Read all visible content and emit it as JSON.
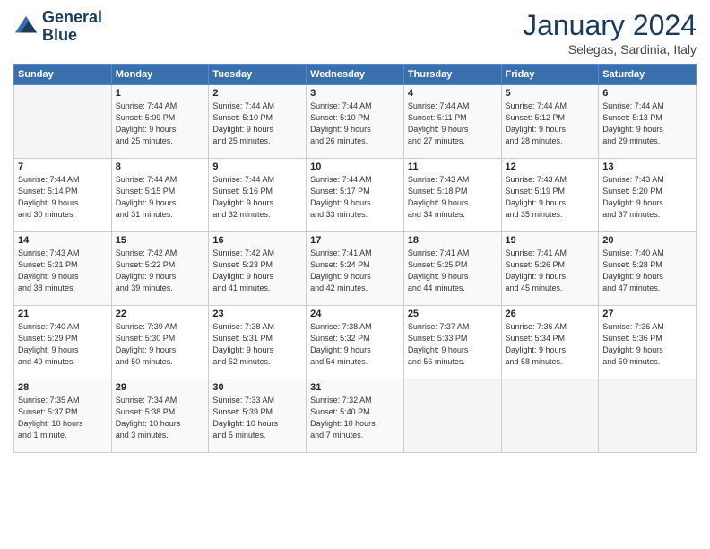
{
  "header": {
    "logo_line1": "General",
    "logo_line2": "Blue",
    "month": "January 2024",
    "location": "Selegas, Sardinia, Italy"
  },
  "weekdays": [
    "Sunday",
    "Monday",
    "Tuesday",
    "Wednesday",
    "Thursday",
    "Friday",
    "Saturday"
  ],
  "weeks": [
    [
      {
        "day": "",
        "info": ""
      },
      {
        "day": "1",
        "info": "Sunrise: 7:44 AM\nSunset: 5:09 PM\nDaylight: 9 hours\nand 25 minutes."
      },
      {
        "day": "2",
        "info": "Sunrise: 7:44 AM\nSunset: 5:10 PM\nDaylight: 9 hours\nand 25 minutes."
      },
      {
        "day": "3",
        "info": "Sunrise: 7:44 AM\nSunset: 5:10 PM\nDaylight: 9 hours\nand 26 minutes."
      },
      {
        "day": "4",
        "info": "Sunrise: 7:44 AM\nSunset: 5:11 PM\nDaylight: 9 hours\nand 27 minutes."
      },
      {
        "day": "5",
        "info": "Sunrise: 7:44 AM\nSunset: 5:12 PM\nDaylight: 9 hours\nand 28 minutes."
      },
      {
        "day": "6",
        "info": "Sunrise: 7:44 AM\nSunset: 5:13 PM\nDaylight: 9 hours\nand 29 minutes."
      }
    ],
    [
      {
        "day": "7",
        "info": "Sunrise: 7:44 AM\nSunset: 5:14 PM\nDaylight: 9 hours\nand 30 minutes."
      },
      {
        "day": "8",
        "info": "Sunrise: 7:44 AM\nSunset: 5:15 PM\nDaylight: 9 hours\nand 31 minutes."
      },
      {
        "day": "9",
        "info": "Sunrise: 7:44 AM\nSunset: 5:16 PM\nDaylight: 9 hours\nand 32 minutes."
      },
      {
        "day": "10",
        "info": "Sunrise: 7:44 AM\nSunset: 5:17 PM\nDaylight: 9 hours\nand 33 minutes."
      },
      {
        "day": "11",
        "info": "Sunrise: 7:43 AM\nSunset: 5:18 PM\nDaylight: 9 hours\nand 34 minutes."
      },
      {
        "day": "12",
        "info": "Sunrise: 7:43 AM\nSunset: 5:19 PM\nDaylight: 9 hours\nand 35 minutes."
      },
      {
        "day": "13",
        "info": "Sunrise: 7:43 AM\nSunset: 5:20 PM\nDaylight: 9 hours\nand 37 minutes."
      }
    ],
    [
      {
        "day": "14",
        "info": "Sunrise: 7:43 AM\nSunset: 5:21 PM\nDaylight: 9 hours\nand 38 minutes."
      },
      {
        "day": "15",
        "info": "Sunrise: 7:42 AM\nSunset: 5:22 PM\nDaylight: 9 hours\nand 39 minutes."
      },
      {
        "day": "16",
        "info": "Sunrise: 7:42 AM\nSunset: 5:23 PM\nDaylight: 9 hours\nand 41 minutes."
      },
      {
        "day": "17",
        "info": "Sunrise: 7:41 AM\nSunset: 5:24 PM\nDaylight: 9 hours\nand 42 minutes."
      },
      {
        "day": "18",
        "info": "Sunrise: 7:41 AM\nSunset: 5:25 PM\nDaylight: 9 hours\nand 44 minutes."
      },
      {
        "day": "19",
        "info": "Sunrise: 7:41 AM\nSunset: 5:26 PM\nDaylight: 9 hours\nand 45 minutes."
      },
      {
        "day": "20",
        "info": "Sunrise: 7:40 AM\nSunset: 5:28 PM\nDaylight: 9 hours\nand 47 minutes."
      }
    ],
    [
      {
        "day": "21",
        "info": "Sunrise: 7:40 AM\nSunset: 5:29 PM\nDaylight: 9 hours\nand 49 minutes."
      },
      {
        "day": "22",
        "info": "Sunrise: 7:39 AM\nSunset: 5:30 PM\nDaylight: 9 hours\nand 50 minutes."
      },
      {
        "day": "23",
        "info": "Sunrise: 7:38 AM\nSunset: 5:31 PM\nDaylight: 9 hours\nand 52 minutes."
      },
      {
        "day": "24",
        "info": "Sunrise: 7:38 AM\nSunset: 5:32 PM\nDaylight: 9 hours\nand 54 minutes."
      },
      {
        "day": "25",
        "info": "Sunrise: 7:37 AM\nSunset: 5:33 PM\nDaylight: 9 hours\nand 56 minutes."
      },
      {
        "day": "26",
        "info": "Sunrise: 7:36 AM\nSunset: 5:34 PM\nDaylight: 9 hours\nand 58 minutes."
      },
      {
        "day": "27",
        "info": "Sunrise: 7:36 AM\nSunset: 5:36 PM\nDaylight: 9 hours\nand 59 minutes."
      }
    ],
    [
      {
        "day": "28",
        "info": "Sunrise: 7:35 AM\nSunset: 5:37 PM\nDaylight: 10 hours\nand 1 minute."
      },
      {
        "day": "29",
        "info": "Sunrise: 7:34 AM\nSunset: 5:38 PM\nDaylight: 10 hours\nand 3 minutes."
      },
      {
        "day": "30",
        "info": "Sunrise: 7:33 AM\nSunset: 5:39 PM\nDaylight: 10 hours\nand 5 minutes."
      },
      {
        "day": "31",
        "info": "Sunrise: 7:32 AM\nSunset: 5:40 PM\nDaylight: 10 hours\nand 7 minutes."
      },
      {
        "day": "",
        "info": ""
      },
      {
        "day": "",
        "info": ""
      },
      {
        "day": "",
        "info": ""
      }
    ]
  ]
}
